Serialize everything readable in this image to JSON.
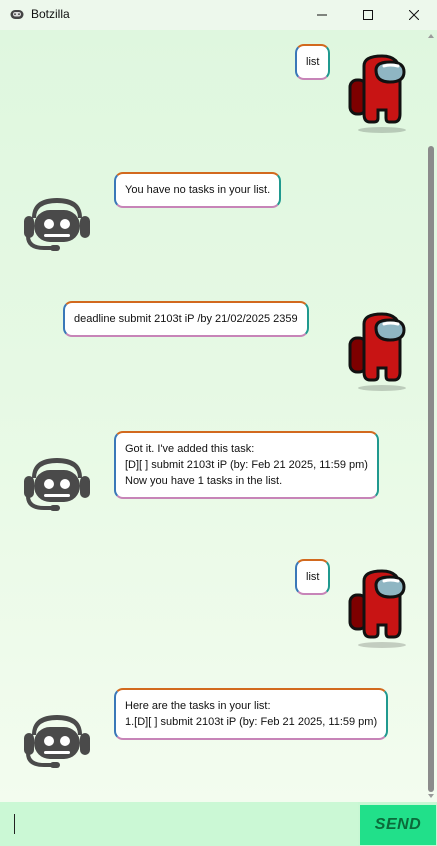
{
  "window": {
    "title": "Botzilla"
  },
  "messages": [
    {
      "sender": "user",
      "text": "list"
    },
    {
      "sender": "bot",
      "text": "You have no tasks in your list."
    },
    {
      "sender": "user",
      "text": "deadline submit 2103t iP /by 21/02/2025 2359"
    },
    {
      "sender": "bot",
      "lines": [
        "Got it. I've added this task:",
        "[D][ ] submit 2103t iP (by: Feb 21 2025, 11:59 pm)",
        "Now you have 1 tasks in the list."
      ]
    },
    {
      "sender": "user",
      "text": "list"
    },
    {
      "sender": "bot",
      "lines": [
        "Here are the tasks in your list:",
        "1.[D][ ] submit 2103t iP (by: Feb 21 2025, 11:59 pm)"
      ]
    }
  ],
  "input": {
    "value": "",
    "placeholder": ""
  },
  "send_button": {
    "label": "SEND"
  },
  "icons": {
    "app": "game-controller-icon",
    "user_avatar": "red-crewmate-icon",
    "bot_avatar": "robot-headset-icon"
  },
  "colors": {
    "send_bg": "#21e08a",
    "chat_bg": "#e3f8e2",
    "user_avatar": "#c81414"
  }
}
